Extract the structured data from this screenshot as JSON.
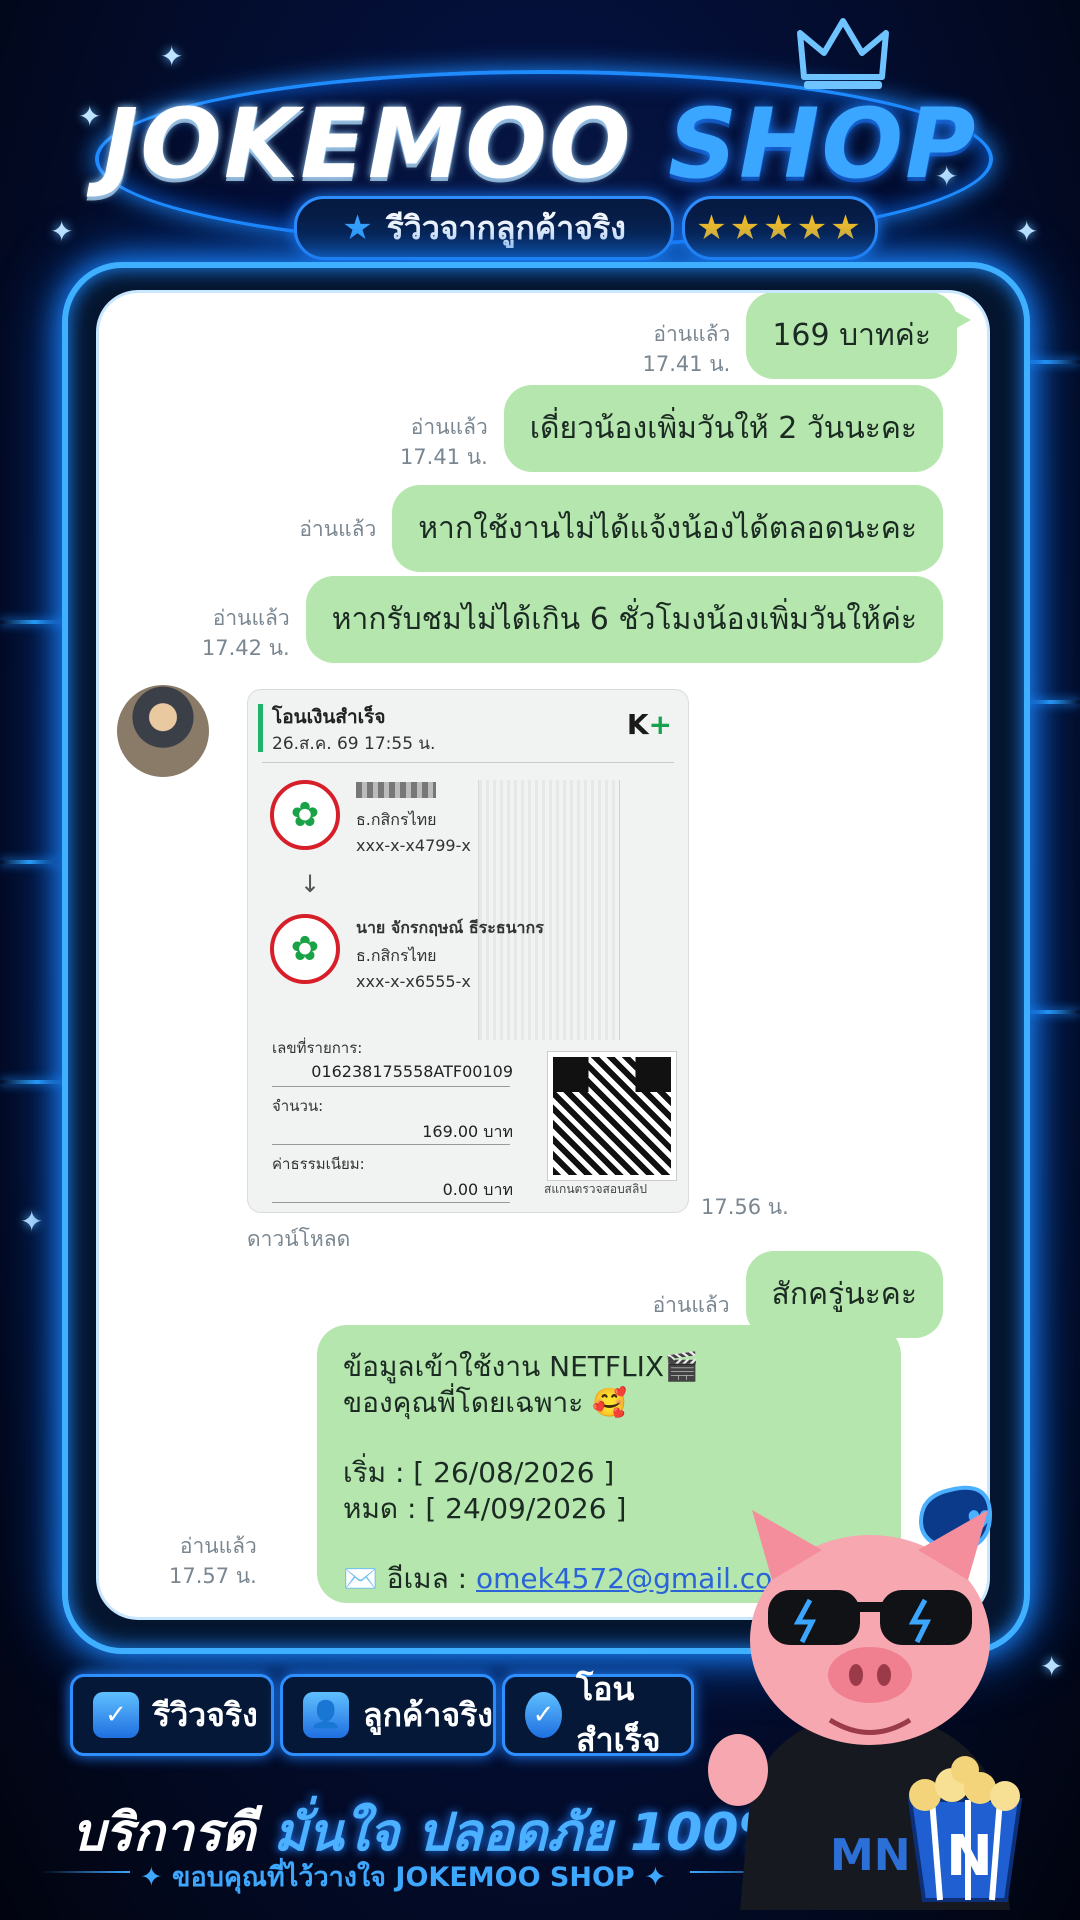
{
  "header": {
    "brand_part1": "JOKEMOO",
    "brand_part2": "SHOP",
    "review_label": "รีวิวจากลูกค้าจริง",
    "stars": "★★★★★"
  },
  "chat": {
    "messages": [
      {
        "read": "อ่านแล้ว",
        "time": "17.41 น.",
        "text": "169 บาทค่ะ"
      },
      {
        "read": "อ่านแล้ว",
        "time": "17.41 น.",
        "text": "เดี่ยวน้องเพิ่มวันให้ 2 วันนะคะ"
      },
      {
        "read": "อ่านแล้ว",
        "time": "",
        "text": "หากใช้งานไม่ได้แจ้งน้องได้ตลอดนะคะ"
      },
      {
        "read": "อ่านแล้ว",
        "time": "17.42 น.",
        "text": "หากรับชมไม่ได้เกิน 6 ชั่วโมงน้องเพิ่มวันให้ค่ะ"
      }
    ],
    "slip": {
      "title": "โอนเงินสำเร็จ",
      "date": "26.ส.ค. 69  17:55 น.",
      "app_logo_k": "K",
      "app_logo_plus": "+",
      "sender_bank": "ธ.กสิกรไทย",
      "sender_account": "xxx-x-x4799-x",
      "receiver_name": "นาย จักรกฤษณ์ ธีระธนากร",
      "receiver_bank": "ธ.กสิกรไทย",
      "receiver_account": "xxx-x-x6555-x",
      "ref_label": "เลขที่รายการ:",
      "ref_value": "016238175558ATF00109",
      "amount_label": "จำนวน:",
      "amount_value": "169.00 บาท",
      "fee_label": "ค่าธรรมเนียม:",
      "fee_value": "0.00 บาท",
      "qr_label": "สแกนตรวจสอบสลิป",
      "time": "17.56 น.",
      "download": "ดาวน์โหลด"
    },
    "msg_wait": {
      "read": "อ่านแล้ว",
      "text": "สักครู่นะคะ"
    },
    "msg_account": {
      "read": "อ่านแล้ว",
      "time": "17.57 น.",
      "line1": "ข้อมูลเข้าใช้งาน NETFLIX🎬",
      "line2": "ของคุณพี่โดยเฉพาะ 🥰",
      "start": "เริ่ม : [ 26/08/2026 ]",
      "end": "หมด : [ 24/09/2026 ]",
      "email_label": "✉️ อีเมล : ",
      "email": "omek4572@gmail.com"
    }
  },
  "badges": [
    {
      "icon": "shield-check",
      "label": "รีวิวจริง"
    },
    {
      "icon": "users",
      "label": "ลูกค้าจริง"
    },
    {
      "icon": "check-circle",
      "label": "โอนสำเร็จ"
    }
  ],
  "footer": {
    "slogan_1": "บริการดี",
    "slogan_2": "มั่นใจ",
    "slogan_3": "ปลอดภัย 100%",
    "thanks": "✦ ขอบคุณที่ไว้วางใจ JOKEMOO SHOP ✦"
  },
  "mascot": {
    "shirt_text": "MN",
    "bucket_letter": "N"
  },
  "colors": {
    "accent": "#3aa6ff",
    "bubble": "#b5e6ad",
    "star": "#ffc21a",
    "bank_green": "#1aa346",
    "bank_red": "#d71f2a"
  }
}
